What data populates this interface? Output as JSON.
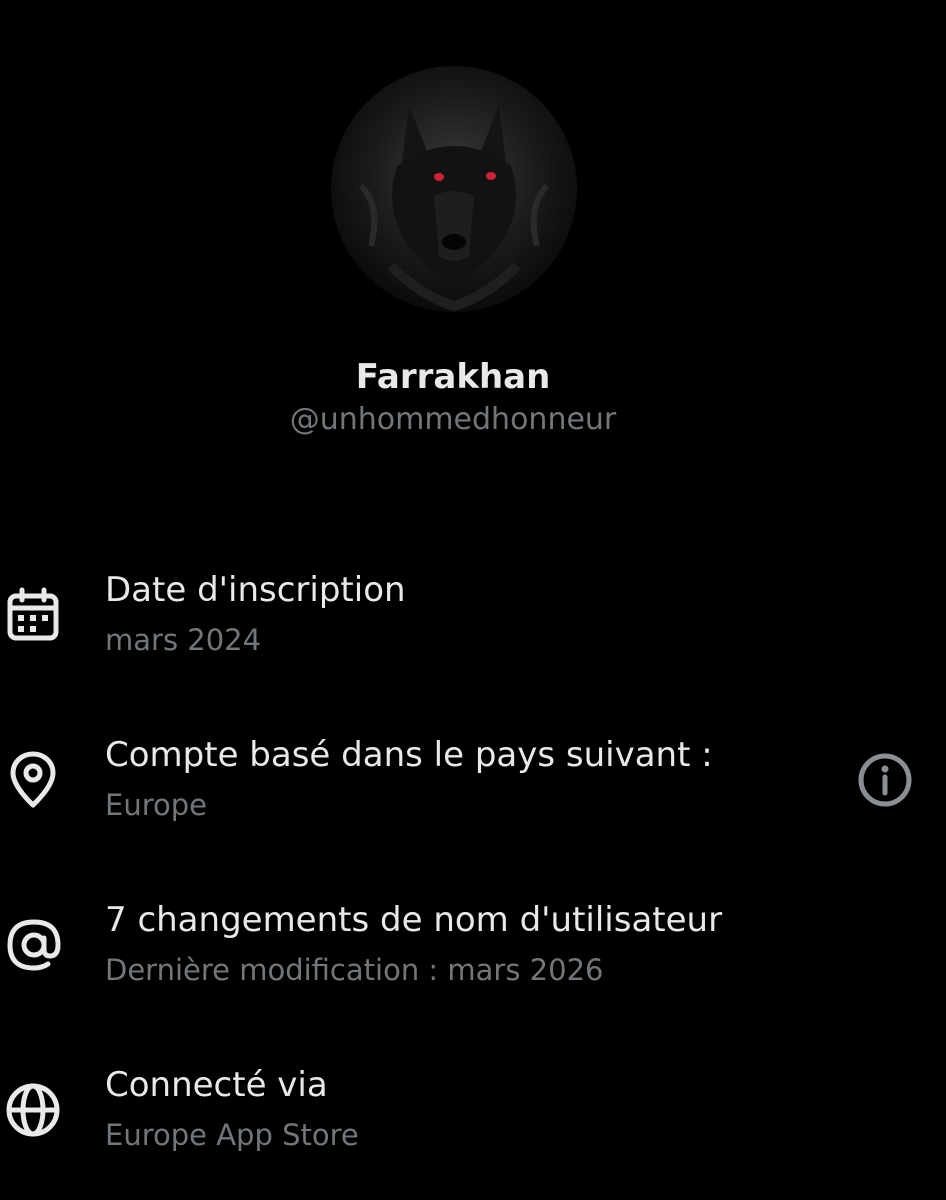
{
  "profile": {
    "display_name": "Farrakhan",
    "handle": "@unhommedhonneur",
    "avatar_icon": "wolf-avatar"
  },
  "about": {
    "joined": {
      "icon": "calendar-icon",
      "label": "Date d'inscription",
      "value": "mars 2024"
    },
    "country": {
      "icon": "location-pin-icon",
      "label": "Compte basé dans le pays suivant :",
      "value": "Europe",
      "info_icon": "info-icon"
    },
    "username_changes": {
      "icon": "at-sign-icon",
      "label": "7 changements de nom d'utilisateur",
      "value": "Dernière modification : mars 2026"
    },
    "connected_via": {
      "icon": "globe-icon",
      "label": "Connecté via",
      "value": "Europe App Store"
    }
  },
  "colors": {
    "background": "#000000",
    "primary_text": "#e7e9ea",
    "secondary_text": "#71767b",
    "avatar_eyes": "#d0203a"
  }
}
